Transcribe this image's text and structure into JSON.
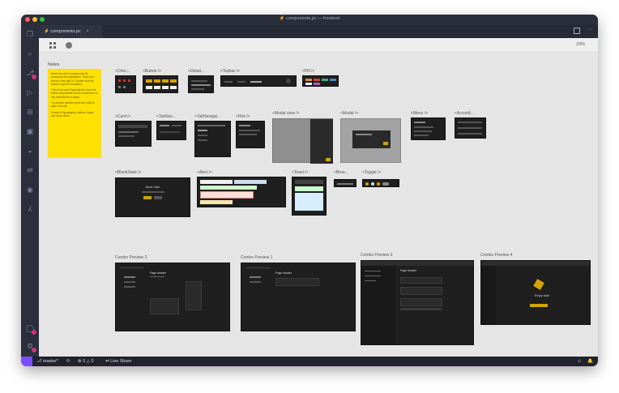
{
  "window": {
    "title": "components.pc — frontend",
    "dirty_glyph": "⚡"
  },
  "activity_bar": {
    "items": [
      "files-icon",
      "search-icon",
      "source-control-icon",
      "run-icon",
      "extensions-icon",
      "remote-icon",
      "docker-icon",
      "live-share-icon",
      "git-icon",
      "github-icon",
      "branch-icon"
    ],
    "bottom": [
      "account-icon",
      "settings-icon"
    ]
  },
  "tab": {
    "label": "components.pc",
    "close": "×"
  },
  "toolbar": {
    "zoom": "23%"
  },
  "notes": {
    "title": "Notes",
    "paragraphs": [
      "Here's the list of components all throughout the application. These are pieces of the app UI. Double click the frame to open it in isolation.",
      "This is the main Paperclip file where all frame components can be customized to any dimensions or styles.",
      "Try another selection and then click to open and edit.",
      "Combo of typography, buttons, inputs, and other views."
    ]
  },
  "frames": {
    "row1": [
      "<Chec...",
      "<Button />",
      "<Detail...",
      "<Topbar />",
      "<Pill />"
    ],
    "row2": [
      "<Card />",
      "<TabNav...",
      "<TabNavigat...",
      "<Hint />",
      "<Modal view />",
      "<Modal />",
      "<Menu />",
      "<Accordi..."
    ],
    "row3": [
      "<BlankSlate />",
      "<Alert />",
      "<Toast />",
      "<Brea...",
      "<Toggle />"
    ],
    "combos": [
      "Combo Preview 2",
      "Combo Preview 1",
      "Combo Preview 3",
      "Combo Preview 4"
    ]
  },
  "inner": {
    "page_header": "Page header",
    "sub": "Some description here",
    "blank_title": "Blank Slate",
    "empty_title": "Empty state"
  },
  "status": {
    "branch": "master*",
    "errors": "0",
    "warnings": "0",
    "live_share": "Live Share"
  },
  "colors": {
    "accent": "#ffd700",
    "note": "#ffe100",
    "artboard": "#1f1f1f",
    "badge": "#d6307a"
  }
}
